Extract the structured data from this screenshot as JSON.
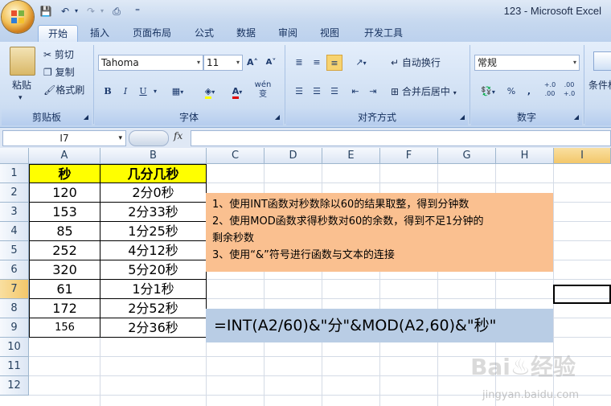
{
  "window": {
    "title": "123 - Microsoft Excel"
  },
  "qat": {
    "save": "💾",
    "undo": "↶",
    "redo": "↷",
    "print": "⎙",
    "customize": "⁼"
  },
  "tabs": [
    "开始",
    "插入",
    "页面布局",
    "公式",
    "数据",
    "审阅",
    "视图",
    "开发工具"
  ],
  "ribbon": {
    "clipboard": {
      "paste": "粘贴",
      "cut": "剪切",
      "copy": "复制",
      "format_painter": "格式刷",
      "label": "剪贴板"
    },
    "font": {
      "name": "Tahoma",
      "size": "11",
      "grow": "A˄",
      "shrink": "A˅",
      "bold": "B",
      "italic": "I",
      "underline": "U",
      "fill": "◈",
      "font_color": "A",
      "phonetic": "wén\n变",
      "label": "字体"
    },
    "alignment": {
      "wrap": "自动换行",
      "merge": "合并后居中",
      "label": "对齐方式"
    },
    "number": {
      "format": "常规",
      "currency": "%",
      "percent": "%",
      "comma": ",",
      "inc": "+.0\n.00",
      "dec": ".00\n+.0",
      "label": "数字"
    },
    "styles": {
      "conditional": "条件格"
    }
  },
  "formula_bar": {
    "name_box": "I7",
    "fx": "fx"
  },
  "sheet": {
    "columns": [
      "A",
      "B",
      "C",
      "D",
      "E",
      "F",
      "G",
      "H",
      "I"
    ],
    "rows": [
      "1",
      "2",
      "3",
      "4",
      "5",
      "6",
      "7",
      "8",
      "9",
      "10",
      "11",
      "12"
    ],
    "selected_column": "I",
    "selected_row": "7",
    "header": [
      "秒",
      "几分几秒"
    ],
    "data": [
      [
        "120",
        "2分0秒"
      ],
      [
        "153",
        "2分33秒"
      ],
      [
        "85",
        "1分25秒"
      ],
      [
        "252",
        "4分12秒"
      ],
      [
        "320",
        "5分20秒"
      ],
      [
        "61",
        "1分1秒"
      ],
      [
        "172",
        "2分52秒"
      ],
      [
        "156",
        "2分36秒"
      ]
    ],
    "note_lines": [
      "1、使用INT函数对秒数除以60的结果取整，得到分钟数",
      "2、使用MOD函数求得秒数对60的余数，得到不足1分钟的",
      "剩余秒数",
      "3、使用“&”符号进行函数与文本的连接"
    ],
    "formula_text": "=INT(A2/60)&\"分\"&MOD(A2,60)&\"秒\""
  },
  "watermark": {
    "brand": "Bai♨经验",
    "url": "jingyan.baidu.com"
  },
  "colors": {
    "header_fill": "#ffff00",
    "note_fill": "#fac090",
    "formula_fill": "#b9cde5",
    "selection": "#f3c76a"
  }
}
